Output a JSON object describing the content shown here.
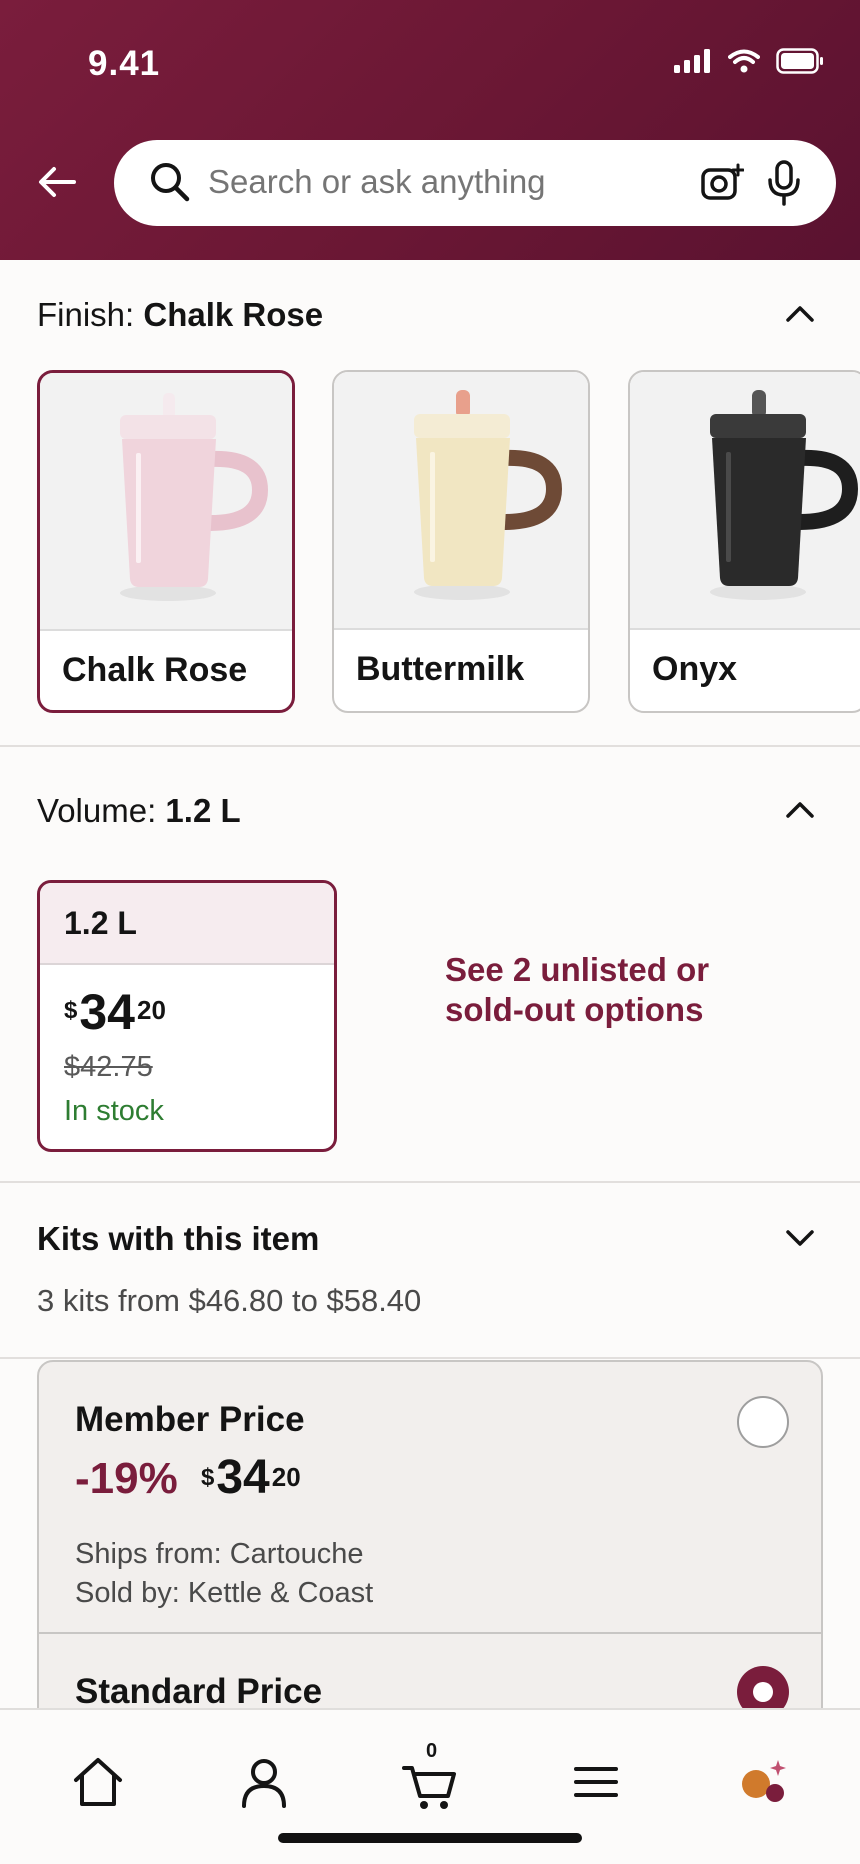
{
  "status_bar": {
    "time": "9.41"
  },
  "search": {
    "placeholder": "Search or ask anything"
  },
  "finish": {
    "label": "Finish:",
    "selected": "Chalk Rose",
    "options": [
      {
        "name": "Chalk Rose",
        "body_color": "#f0d4dc",
        "handle_color": "#e8c2cd",
        "lid_color": "#f3e2e7",
        "straw_color": "#f5eaee",
        "selected": true
      },
      {
        "name": "Buttermilk",
        "body_color": "#f1e6c2",
        "handle_color": "#6e4a36",
        "lid_color": "#f4ecd4",
        "straw_color": "#e8a08c",
        "selected": false
      },
      {
        "name": "Onyx",
        "body_color": "#2a2a2a",
        "handle_color": "#1e1e1e",
        "lid_color": "#3a3a3a",
        "straw_color": "#555555",
        "selected": false
      }
    ]
  },
  "volume": {
    "label": "Volume:",
    "selected": "1.2 L",
    "option": {
      "size": "1.2 L",
      "currency": "$",
      "price_whole": "34",
      "price_cents": "20",
      "was_price": "$42.75",
      "stock": "In stock"
    },
    "see_more": "See 2 unlisted or sold-out options"
  },
  "kits": {
    "title": "Kits with this item",
    "subtitle": "3 kits from $46.80 to $58.40"
  },
  "price_options": {
    "member": {
      "title": "Member Price",
      "discount": "-19%",
      "currency": "$",
      "price_whole": "34",
      "price_cents": "20",
      "ships_from": "Ships from: Cartouche",
      "sold_by": "Sold by: Kettle & Coast"
    },
    "standard": {
      "title": "Standard Price"
    }
  },
  "bottom_nav": {
    "cart_count": "0",
    "items": [
      "home-icon",
      "account-icon",
      "cart-icon",
      "menu-icon",
      "assistant-icon"
    ]
  },
  "colors": {
    "brand": "#7a1d3c",
    "in_stock": "#2e7d32"
  }
}
